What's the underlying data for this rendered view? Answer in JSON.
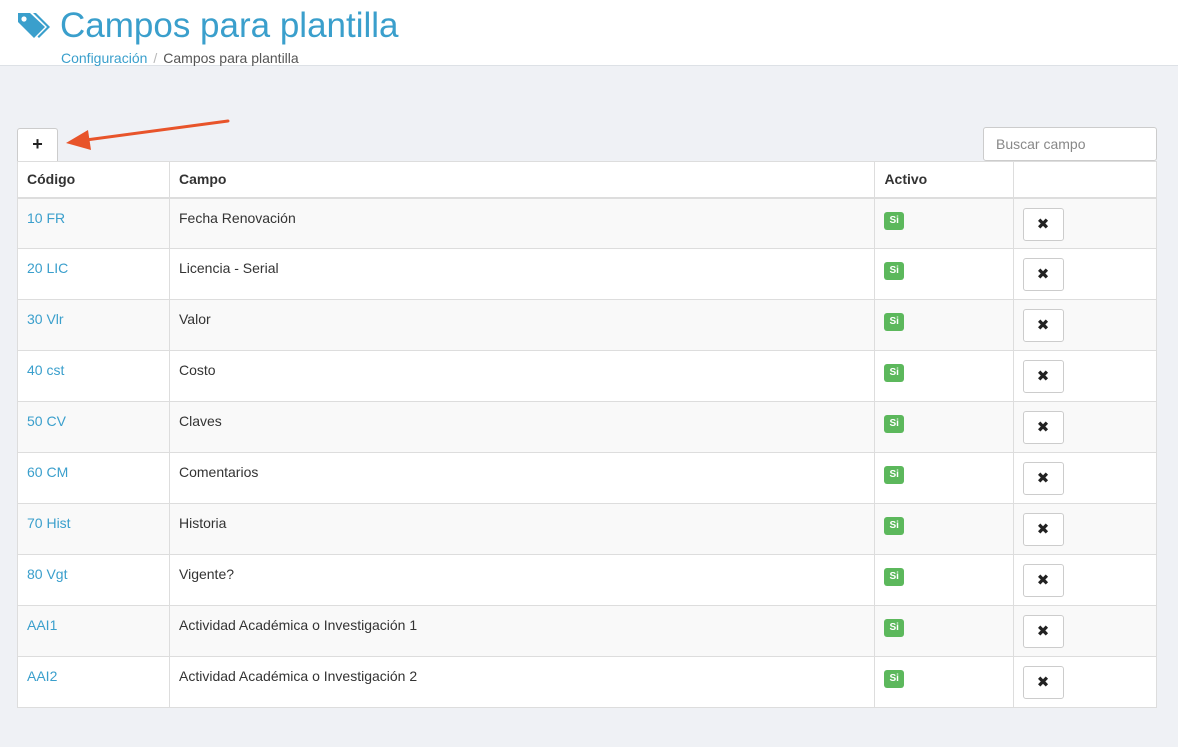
{
  "header": {
    "title": "Campos para plantilla",
    "breadcrumb": {
      "parent": "Configuración",
      "separator": "/",
      "current": "Campos para plantilla"
    }
  },
  "toolbar": {
    "add_label": "+",
    "search_placeholder": "Buscar campo"
  },
  "table": {
    "columns": [
      "Código",
      "Campo",
      "Activo",
      ""
    ],
    "rows": [
      {
        "code": "10 FR",
        "field": "Fecha Renovación",
        "active": "Si",
        "delete": "✖"
      },
      {
        "code": "20 LIC",
        "field": "Licencia - Serial",
        "active": "Si",
        "delete": "✖"
      },
      {
        "code": "30 Vlr",
        "field": "Valor",
        "active": "Si",
        "delete": "✖"
      },
      {
        "code": "40 cst",
        "field": "Costo",
        "active": "Si",
        "delete": "✖"
      },
      {
        "code": "50 CV",
        "field": "Claves",
        "active": "Si",
        "delete": "✖"
      },
      {
        "code": "60 CM",
        "field": "Comentarios",
        "active": "Si",
        "delete": "✖"
      },
      {
        "code": "70 Hist",
        "field": "Historia",
        "active": "Si",
        "delete": "✖"
      },
      {
        "code": "80 Vgt",
        "field": "Vigente?",
        "active": "Si",
        "delete": "✖"
      },
      {
        "code": "AAI1",
        "field": "Actividad Académica o Investigación 1",
        "active": "Si",
        "delete": "✖"
      },
      {
        "code": "AAI2",
        "field": "Actividad Académica o Investigación 2",
        "active": "Si",
        "delete": "✖"
      }
    ]
  },
  "colors": {
    "accent": "#3a9fcc",
    "success_badge": "#5cb85c",
    "annotation_arrow": "#e8542a",
    "page_background": "#eff1f5"
  },
  "icons": {
    "title_icon": "tags-icon",
    "delete_icon": "close-icon",
    "annotation": "arrow-icon"
  }
}
